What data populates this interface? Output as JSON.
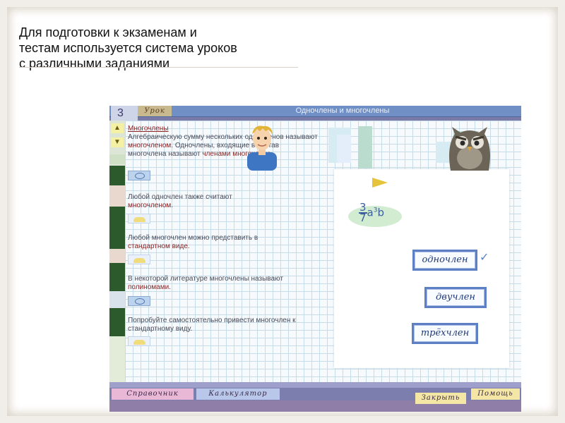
{
  "slide": {
    "caption_lines": [
      "Для подготовки к экзаменам и",
      "тестам используется система уроков",
      "с различными заданиями"
    ]
  },
  "app": {
    "lesson_number": "3",
    "lesson_tag": "Урок",
    "lesson_title": "Одночлены и многочлены",
    "nav": {
      "up_icon": "triangle-up-icon",
      "down_icon": "triangle-down-icon"
    },
    "content": {
      "heading": "Многочлены",
      "p1_a": "Алгебраическую сумму нескольких одночленов называют ",
      "p1_term": "многочленом",
      "p1_b": ". Одночлены, входящие в состав многочлена называют ",
      "p1_term2": "членами многочлена",
      "p1_c": ".",
      "p2_a": "Любой одночлен также считают ",
      "p2_term": "многочленом",
      "p2_b": ".",
      "p3_a": "Любой многочлен можно представить в ",
      "p3_term": "стандартном виде",
      "p3_b": ".",
      "p4_a": "В некоторой литературе многочлены называют ",
      "p4_term": "полиномами",
      "p4_b": ".",
      "p5": "Попробуйте самостоятельно привести многочлен к стандартному виду."
    },
    "exercise": {
      "formula_num": "3",
      "formula_den": "7",
      "formula_tail": "a",
      "formula_sup": "3",
      "formula_var2": "b",
      "answers": [
        "одночлен",
        "двучлен",
        "трёхчлен"
      ],
      "checkmark": "✓"
    },
    "toolbar": {
      "reference": "Справочник",
      "calculator": "Калькулятор",
      "close": "Закрыть",
      "help": "Помощь"
    }
  }
}
